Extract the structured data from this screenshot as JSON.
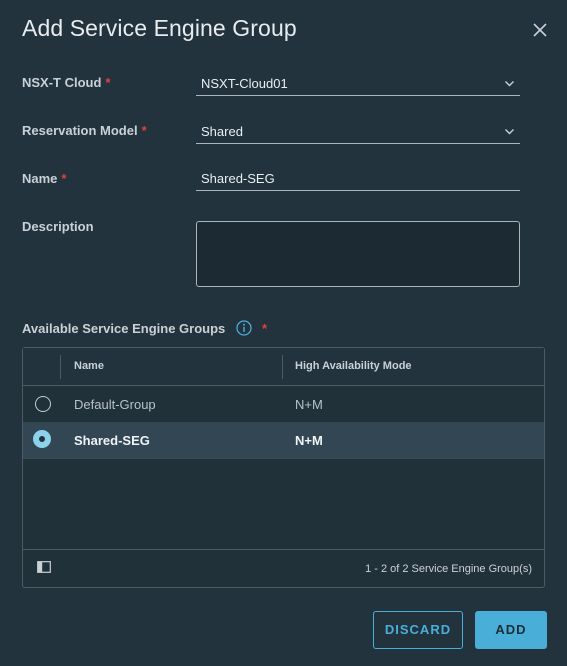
{
  "dialog": {
    "title": "Add Service Engine Group"
  },
  "form": {
    "nsxt_cloud": {
      "label": "NSX-T Cloud",
      "value": "NSXT-Cloud01"
    },
    "reservation_model": {
      "label": "Reservation Model",
      "value": "Shared"
    },
    "name": {
      "label": "Name",
      "value": "Shared-SEG"
    },
    "description": {
      "label": "Description",
      "value": ""
    },
    "available_groups_label": "Available Service Engine Groups",
    "required_mark": "*"
  },
  "grid": {
    "columns": [
      "Name",
      "High Availability Mode"
    ],
    "rows": [
      {
        "name": "Default-Group",
        "ha_mode": "N+M",
        "selected": false
      },
      {
        "name": "Shared-SEG",
        "ha_mode": "N+M",
        "selected": true
      }
    ],
    "footer": "1 - 2 of 2 Service Engine Group(s)"
  },
  "buttons": {
    "discard": "DISCARD",
    "add": "ADD"
  },
  "colors": {
    "background": "#22333d",
    "accent": "#49afd9",
    "required": "#e0413f",
    "selected_row": "#324753"
  },
  "icons": {
    "close": "close-icon",
    "info": "info-icon",
    "chevron": "chevron-down-icon",
    "column_toggle": "column-toggle-icon"
  }
}
